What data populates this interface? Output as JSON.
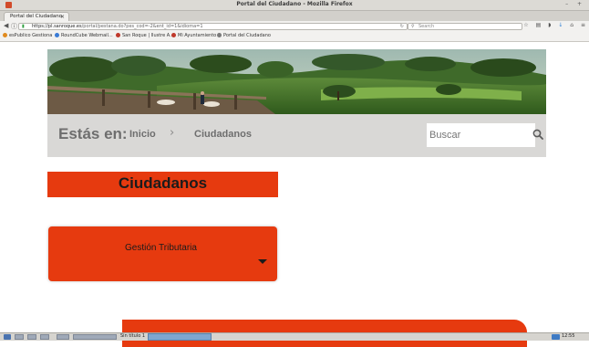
{
  "window": {
    "title": "Portal del Ciudadano - Mozilla Firefox",
    "controls": "– +"
  },
  "browser": {
    "tab_title": "Portal del Ciudadano",
    "tab_close": "×",
    "new_tab": "+",
    "url_host": "https://pl.sanroque.es",
    "url_path": "/portal/pestana.do?pes_cod=-2&ent_id=1&idioma=1",
    "search_placeholder": "Search",
    "bookmarks": [
      {
        "label": "esPublico Gestiona",
        "color": "#e08a1e"
      },
      {
        "label": "RoundCube Webmail...",
        "color": "#3a7bd5"
      },
      {
        "label": "San Roque | Ilustre A...",
        "color": "#c0392b"
      },
      {
        "label": "Mi Ayuntamiento",
        "color": "#c0392b"
      },
      {
        "label": "Portal del Ciudadano",
        "color": "#7a7a7a"
      }
    ]
  },
  "page": {
    "breadcrumb": {
      "prefix": "Estás en:",
      "home": "Inicio",
      "separator": "›",
      "current": "Ciudadanos"
    },
    "search": {
      "placeholder": "Buscar"
    },
    "section_title": "Ciudadanos",
    "accordion": {
      "label": "Gestión Tributaria",
      "expanded": false
    },
    "colors": {
      "accent": "#e63a0f",
      "breadcrumb_bg": "#d9d8d6",
      "breadcrumb_text": "#6e6e6e"
    }
  },
  "taskbar": {
    "task_label": "Sin título 1",
    "clock": "12:55"
  }
}
